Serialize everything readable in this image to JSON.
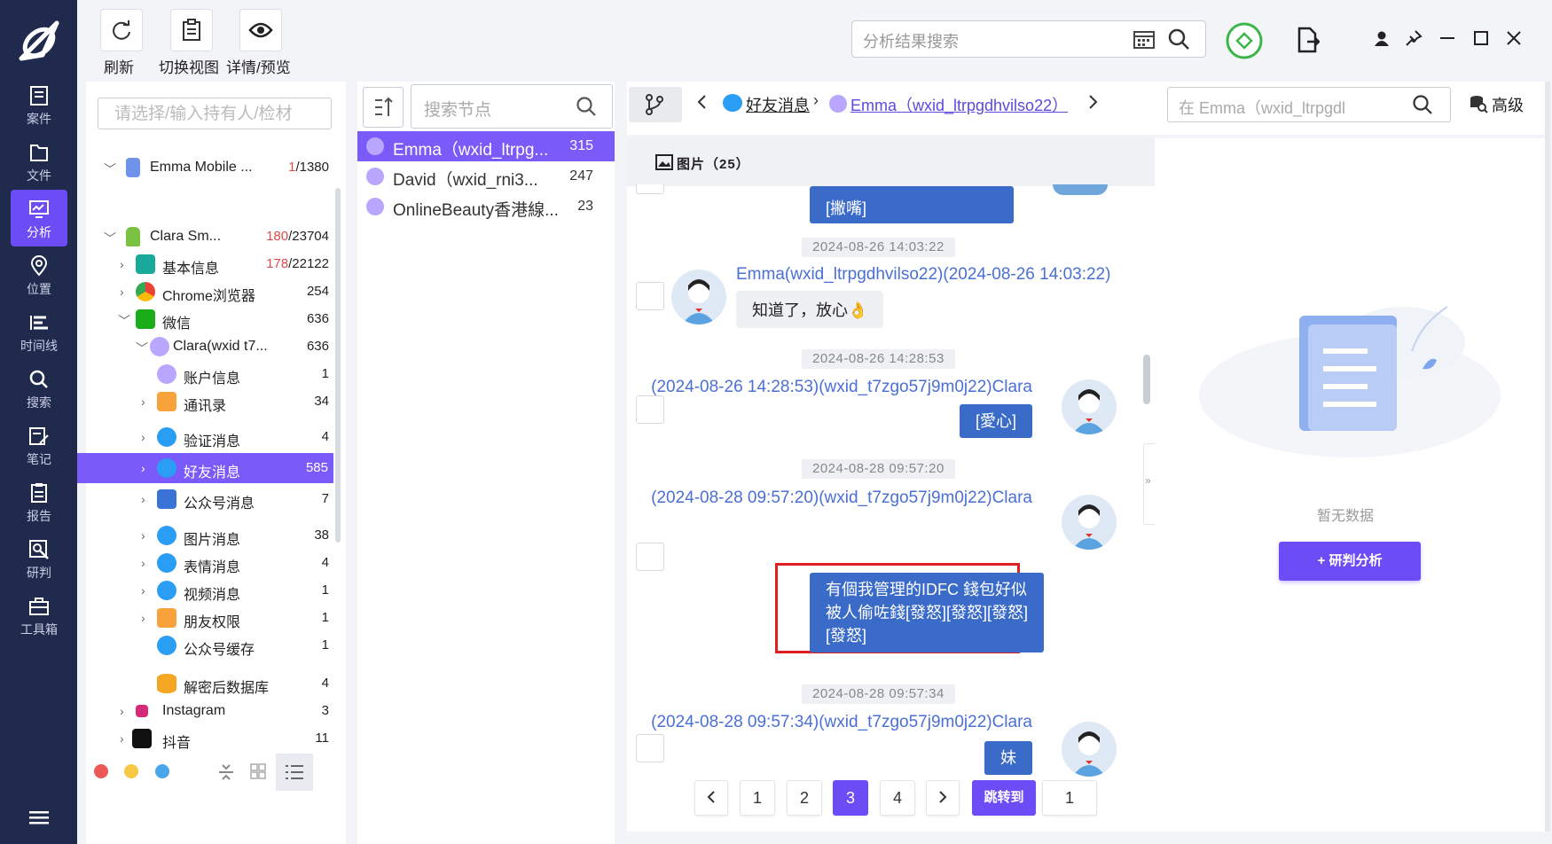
{
  "toolbar": {
    "refresh_label": "刷新",
    "switch_view_label": "切换视图",
    "details_label": "详情/预览"
  },
  "search": {
    "placeholder": "分析结果搜索"
  },
  "nav": {
    "items": [
      {
        "label": "案件"
      },
      {
        "label": "文件"
      },
      {
        "label": "分析"
      },
      {
        "label": "位置"
      },
      {
        "label": "时间线"
      },
      {
        "label": "搜索"
      },
      {
        "label": "笔记"
      },
      {
        "label": "报告"
      },
      {
        "label": "研判"
      },
      {
        "label": "工具箱"
      }
    ]
  },
  "tree": {
    "owner_placeholder": "请选择/输入持有人/检材",
    "rows": [
      {
        "label": "Emma Mobile ...",
        "count_hit": "1",
        "count_total": "/1380"
      },
      {
        "label": "Clara Sm...",
        "count_hit": "180",
        "count_total": "/23704"
      },
      {
        "label": "基本信息",
        "count_hit": "178",
        "count_total": "/22122"
      },
      {
        "label": "Chrome浏览器",
        "count": "254"
      },
      {
        "label": "微信",
        "count": "636"
      },
      {
        "label": "Clara(wxid t7...",
        "count": "636"
      },
      {
        "label": "账户信息",
        "count": "1"
      },
      {
        "label": "通讯录",
        "count": "34"
      },
      {
        "label": "验证消息",
        "count": "4"
      },
      {
        "label": "好友消息",
        "count": "585"
      },
      {
        "label": "公众号消息",
        "count": "7"
      },
      {
        "label": "图片消息",
        "count": "38"
      },
      {
        "label": "表情消息",
        "count": "4"
      },
      {
        "label": "视频消息",
        "count": "1"
      },
      {
        "label": "朋友权限",
        "count": "1"
      },
      {
        "label": "公众号缓存",
        "count": "1"
      },
      {
        "label": "解密后数据库",
        "count": "4"
      },
      {
        "label": "Instagram",
        "count": "3"
      },
      {
        "label": "抖音",
        "count": "11"
      }
    ]
  },
  "contacts": {
    "search_placeholder": "搜索节点",
    "rows": [
      {
        "name": "Emma（wxid_ltrpg...",
        "count": "315"
      },
      {
        "name": "David（wxid_rni3...",
        "count": "247"
      },
      {
        "name": "OnlineBeauty香港線...",
        "count": "23"
      }
    ]
  },
  "chat": {
    "breadcrumb_1": "好友消息",
    "breadcrumb_2": "Emma（wxid_ltrpgdhvilso22）",
    "in_search_placeholder": "在 Emma（wxid_ltrpgdl",
    "advanced_label": "高级",
    "tab_label": "图片（25）",
    "messages": [
      {
        "text": "[撇嘴]"
      },
      {
        "timestamp": "2024-08-26 14:03:22",
        "sender": "Emma(wxid_ltrpgdhvilso22)(2024-08-26 14:03:22)",
        "text": "知道了，放心👌"
      },
      {
        "timestamp": "2024-08-26 14:28:53",
        "sender": "(2024-08-26 14:28:53)(wxid_t7zgo57j9m0j22)Clara",
        "text": "[愛心]"
      },
      {
        "timestamp": "2024-08-28 09:57:20",
        "sender": "(2024-08-28 09:57:20)(wxid_t7zgo57j9m0j22)Clara",
        "text_lines": [
          "有個我管理的IDFC 錢包好似",
          "被人偷咗錢[發怒][發怒][發怒]",
          "[發怒]"
        ]
      },
      {
        "timestamp": "2024-08-28 09:57:34",
        "sender": "(2024-08-28 09:57:34)(wxid_t7zgo57j9m0j22)Clara",
        "text": "妹"
      }
    ],
    "pagination": {
      "pages": [
        "1",
        "2",
        "3",
        "4"
      ],
      "current": "3",
      "jump_label": "跳转到",
      "jump_value": "1"
    }
  },
  "side": {
    "empty_label": "暂无数据",
    "analyze_button": "+ 研判分析"
  },
  "colors": {
    "nav_bg": "#1f2a4d",
    "accent": "#6c4df5",
    "bubble_out": "#3a6bc8",
    "highlight_border": "#e02020"
  }
}
